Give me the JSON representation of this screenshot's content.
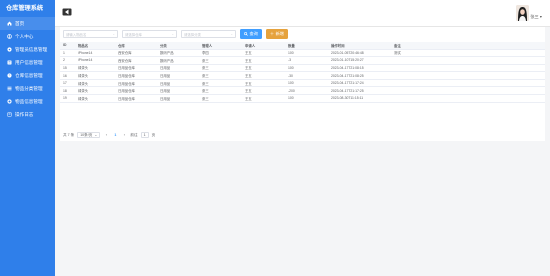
{
  "app": {
    "title": "仓库管理系统"
  },
  "sidebar": {
    "items": [
      {
        "label": "首页",
        "icon": "home-icon"
      },
      {
        "label": "个人中心",
        "icon": "user-icon"
      },
      {
        "label": "管理员信息管理",
        "icon": "admin-icon"
      },
      {
        "label": "用户信息管理",
        "icon": "users-icon"
      },
      {
        "label": "仓库信息管理",
        "icon": "question-icon"
      },
      {
        "label": "物品分类管理",
        "icon": "list-icon"
      },
      {
        "label": "物品信息管理",
        "icon": "box-icon"
      },
      {
        "label": "操作日志",
        "icon": "log-icon"
      }
    ]
  },
  "header": {
    "username": "张三"
  },
  "filters": {
    "item_placeholder": "请输入物品名",
    "warehouse_placeholder": "请选择仓库",
    "category_placeholder": "请选择分类",
    "query_label": "查询",
    "add_label": "新增"
  },
  "table": {
    "columns": [
      "ID",
      "物品名",
      "仓库",
      "分类",
      "管理人",
      "申请人",
      "数量",
      "操作时间",
      "备注"
    ],
    "rows": [
      [
        "1",
        "iPhone14",
        "西安仓库",
        "数码产品",
        "李四",
        "王五",
        "100",
        "2023-01-05T20:46:48",
        "测试"
      ],
      [
        "2",
        "iPhone14",
        "西安仓库",
        "数码产品",
        "张三",
        "王五",
        "-3",
        "2023-01-10T15:20:27",
        ""
      ],
      [
        "15",
        "绿茶头",
        "日用品仓库",
        "日用品",
        "张三",
        "王五",
        "100",
        "2023-04-17T21:08:15",
        ""
      ],
      [
        "16",
        "绿茶头",
        "日用品仓库",
        "日用品",
        "张三",
        "王五",
        "-30",
        "2023-04-17T21:08:25",
        ""
      ],
      [
        "17",
        "绿茶头",
        "日用品仓库",
        "日用品",
        "张三",
        "王五",
        "100",
        "2023-04-17T21:17:24",
        ""
      ],
      [
        "18",
        "绿茶头",
        "日用品仓库",
        "日用品",
        "张三",
        "王五",
        "-200",
        "2023-04-17T21:17:25",
        ""
      ],
      [
        "19",
        "绿茶头",
        "日用品仓库",
        "日用品",
        "张三",
        "王五",
        "100",
        "2023-08-30T11:15:11",
        ""
      ]
    ]
  },
  "pagination": {
    "total": "共 7 条",
    "page_size": "10条/页",
    "prev": "‹",
    "current": "1",
    "next": "›",
    "goto_label": "前往",
    "goto_value": "1",
    "page_suffix": "页"
  },
  "colors": {
    "sidebar": "#2f7fea",
    "query": "#409eff",
    "add": "#e6a23c"
  }
}
